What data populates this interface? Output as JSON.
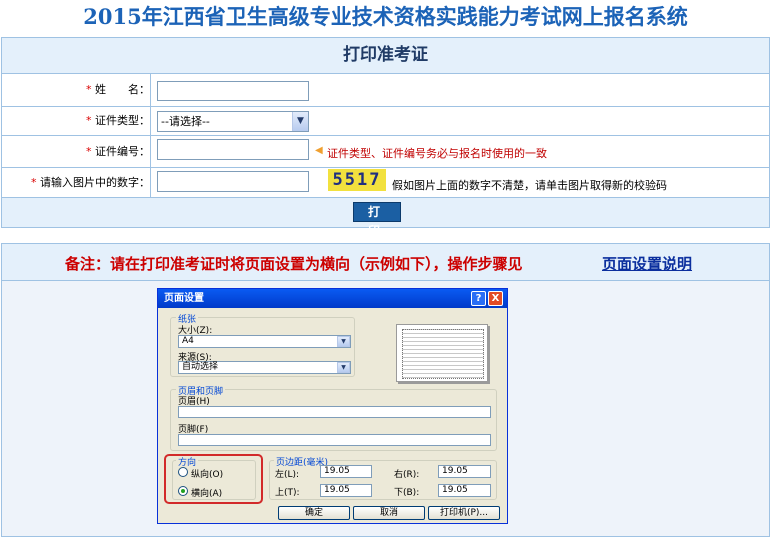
{
  "header": {
    "title": "2015年江西省卫生高级专业技术资格实践能力考试网上报名系统"
  },
  "form": {
    "heading": "打印准考证",
    "required_mark": "*",
    "name_label": "姓　　名：",
    "id_type_label": "证件类型：",
    "id_type_value": "--请选择--",
    "id_no_label": "证件编号：",
    "id_no_hint": "证件类型、证件编号务必与报名时使用的一致",
    "captcha_label": "请输入图片中的数字：",
    "captcha_value": "5517",
    "captcha_hint": "假如图片上面的数字不清楚，请单击图片取得新的校验码",
    "print_button": "打 印"
  },
  "note": {
    "text": "备注：请在打印准考证时将页面设置为横向（示例如下），操作步骤见",
    "link": "页面设置说明"
  },
  "dialog": {
    "title": "页面设置",
    "help": "?",
    "close": "X",
    "paper_group": "纸张",
    "size_label": "大小(Z):",
    "size_value": "A4",
    "source_label": "来源(S):",
    "source_value": "自动选择",
    "header_footer_group": "页眉和页脚",
    "header_label": "页眉(H)",
    "footer_label": "页脚(F)",
    "orientation_group": "方向",
    "portrait": "纵向(O)",
    "landscape": "横向(A)",
    "margins_group": "页边距(毫米)",
    "left_label": "左(L):",
    "left_value": "19.05",
    "right_label": "右(R):",
    "right_value": "19.05",
    "top_label": "上(T):",
    "top_value": "19.05",
    "bottom_label": "下(B):",
    "bottom_value": "19.05",
    "ok_button": "确定",
    "cancel_button": "取消",
    "printer_button": "打印机(P)..."
  },
  "colors": {
    "title": "#1c63b7",
    "accent_red": "#cc0000",
    "header_bg": "#e4f0fb",
    "border": "#9fc2e3"
  },
  "icons": {
    "dropdown": "chevron-down-icon",
    "hint": "triangle-left-icon"
  }
}
